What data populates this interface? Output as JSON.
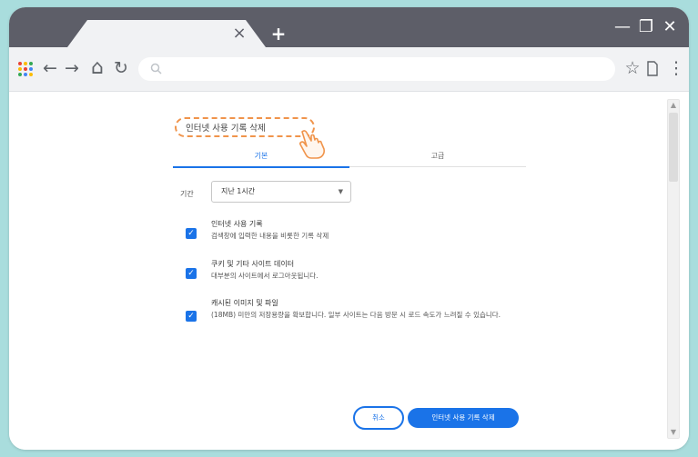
{
  "browser": {
    "tab_close_glyph": "×",
    "new_tab_glyph": "+",
    "window_controls": {
      "minimize": "—",
      "restore": "❐",
      "close": "✕"
    },
    "apps_dot_colors": [
      "#e94235",
      "#fbbc05",
      "#34a853",
      "#fbbc05",
      "#e94235",
      "#4285f4",
      "#34a853",
      "#4285f4",
      "#fbbc05"
    ],
    "nav": {
      "back": "←",
      "forward": "→",
      "home": "⌂",
      "reload": "↻",
      "bookmark": "☆",
      "menu": "⋮"
    }
  },
  "dialog": {
    "title": "인터넷 사용 기록 삭제",
    "tabs": [
      {
        "label": "기본"
      },
      {
        "label": "고급"
      }
    ],
    "time_range": {
      "label": "기간",
      "value": "지난 1시간"
    },
    "options": [
      {
        "title": "인터넷 사용 기록",
        "desc": "검색창에 입력한 내용을 비롯한 기록 삭제",
        "checked": true
      },
      {
        "title": "쿠키 및 기타 사이트 데이터",
        "desc": "대부분의 사이트에서 로그아웃됩니다.",
        "checked": true
      },
      {
        "title": "캐시된 이미지 및 파일",
        "desc": "(18MB) 미만의 저장용량을 확보합니다. 일부 사이트는 다음 방문 시 로드 속도가 느려질 수 있습니다.",
        "checked": true
      }
    ],
    "buttons": {
      "cancel": "취소",
      "confirm": "인터넷 사용 기록 삭제"
    }
  },
  "colors": {
    "accent": "#1a73e8",
    "highlight_dash": "#f0944b",
    "titlebar": "#5d5e68",
    "background": "#a9dddd"
  }
}
